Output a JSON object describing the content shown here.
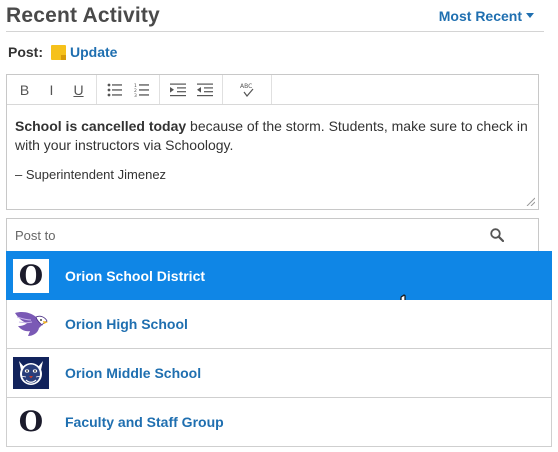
{
  "header": {
    "title": "Recent Activity",
    "sort_label": "Most Recent"
  },
  "post": {
    "label": "Post:",
    "type_icon": "note-icon",
    "type_label": "Update"
  },
  "toolbar": {
    "bold": "B",
    "italic": "I",
    "underline": "U",
    "icons": [
      "bullet-list-icon",
      "numbered-list-icon",
      "indent-icon",
      "outdent-icon",
      "spellcheck-icon"
    ]
  },
  "editor": {
    "bold_text": "School is cancelled today",
    "rest_text": " because of the storm. Students, make sure to check in with your instructors via Schoology.",
    "signature": "– Superintendent Jimenez"
  },
  "post_to": {
    "placeholder": "Post to"
  },
  "options": [
    {
      "label": "Orion School District",
      "logo": "O",
      "selected": true
    },
    {
      "label": "Orion High School",
      "logo": "eagle-logo",
      "selected": false
    },
    {
      "label": "Orion Middle School",
      "logo": "wildcat-logo",
      "selected": false
    },
    {
      "label": "Faculty and Staff Group",
      "logo": "O",
      "selected": false
    }
  ],
  "colors": {
    "accent": "#1f6fb0",
    "selected_bg": "#0f86e6",
    "note_yellow": "#f6c11b"
  }
}
